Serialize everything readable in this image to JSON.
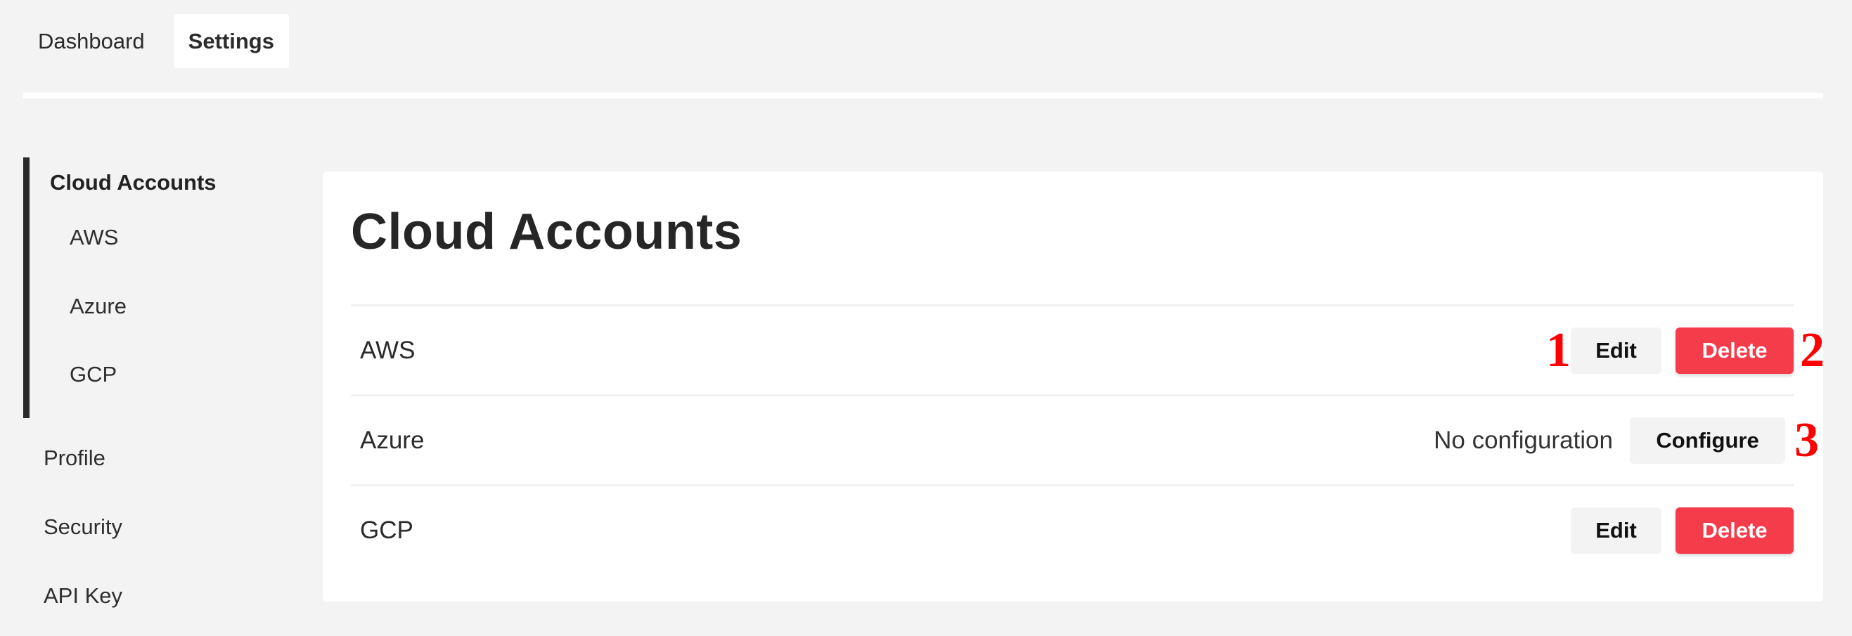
{
  "topnav": {
    "tabs": [
      {
        "label": "Dashboard",
        "active": false
      },
      {
        "label": "Settings",
        "active": true
      }
    ]
  },
  "sidebar": {
    "group_title": "Cloud Accounts",
    "subitems": [
      {
        "label": "AWS"
      },
      {
        "label": "Azure"
      },
      {
        "label": "GCP"
      }
    ],
    "items": [
      {
        "label": "Profile"
      },
      {
        "label": "Security"
      },
      {
        "label": "API Key"
      }
    ]
  },
  "main": {
    "title": "Cloud Accounts",
    "rows": [
      {
        "name": "AWS",
        "status": "",
        "edit_label": "Edit",
        "delete_label": "Delete"
      },
      {
        "name": "Azure",
        "status": "No configuration",
        "configure_label": "Configure"
      },
      {
        "name": "GCP",
        "status": "",
        "edit_label": "Edit",
        "delete_label": "Delete"
      }
    ]
  },
  "annotations": [
    "1",
    "2",
    "3"
  ],
  "colors": {
    "background": "#f3f3f3",
    "panel": "#ffffff",
    "danger": "#f53c4b",
    "neutral_button": "#f3f3f3",
    "annotation": "#ff0000"
  }
}
